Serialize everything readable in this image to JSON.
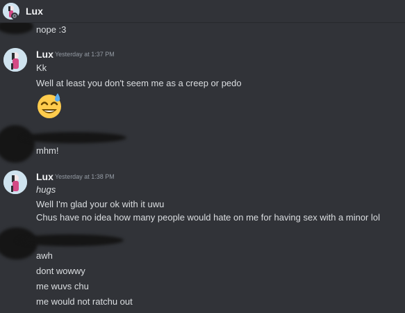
{
  "header": {
    "title": "Lux"
  },
  "messages": [
    {
      "continuation": "nope :3"
    },
    {
      "author": "Lux",
      "timestamp": "Yesterday at 1:37 PM",
      "lines": [
        "Kk",
        "Well at least you don't seem me as a creep or pedo"
      ],
      "emoji": "sweat-smile-emoji"
    },
    {
      "lines": [
        "mhm!"
      ]
    },
    {
      "author": "Lux",
      "timestamp": "Yesterday at 1:38 PM",
      "lines": [
        "hugs",
        "Well I'm glad your ok with it uwu",
        "Chus have no idea how many people would hate on me for having sex with a minor lol"
      ]
    },
    {
      "lines": [
        "awh",
        "dont wowwy",
        "me wuvs chu",
        "me would not ratchu out"
      ]
    }
  ],
  "colors": {
    "background": "#313338",
    "text": "#dbdee1",
    "name": "#f2f3f5",
    "timestamp": "#949ba4",
    "redaction": "#151515"
  }
}
